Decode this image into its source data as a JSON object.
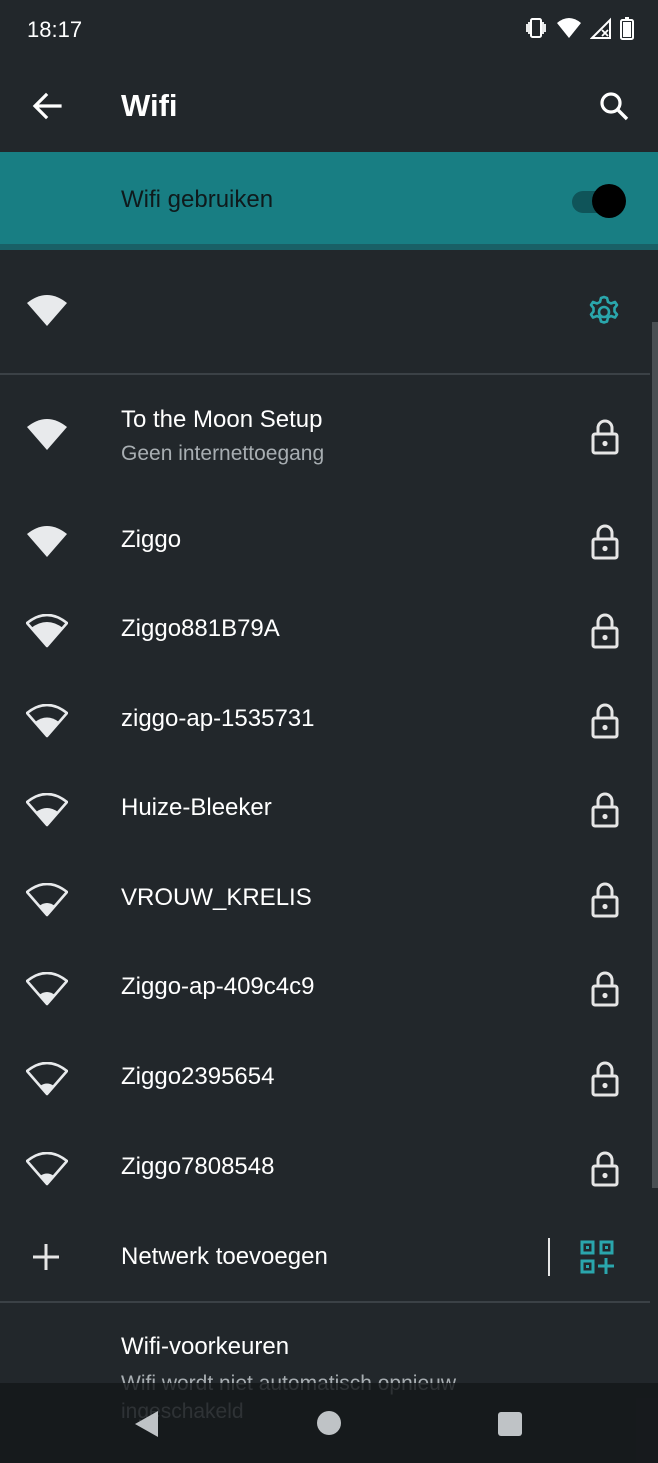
{
  "status_bar": {
    "time": "18:17"
  },
  "app_bar": {
    "title": "Wifi"
  },
  "toggle": {
    "label": "Wifi gebruiken",
    "on": true
  },
  "networks": [
    {
      "name": "To the Moon Setup",
      "subtitle": "Geen internettoegang"
    },
    {
      "name": "Ziggo"
    },
    {
      "name": "Ziggo881B79A"
    },
    {
      "name": "ziggo-ap-1535731"
    },
    {
      "name": "Huize-Bleeker"
    },
    {
      "name": "VROUW_KRELIS"
    },
    {
      "name": "Ziggo-ap-409c4c9"
    },
    {
      "name": "Ziggo2395654"
    },
    {
      "name": "Ziggo7808548"
    }
  ],
  "add_network": {
    "label": "Netwerk toevoegen"
  },
  "preferences": {
    "title": "Wifi-voorkeuren",
    "subtitle": "Wifi wordt niet automatisch opnieuw ingeschakeld"
  },
  "colors": {
    "accent": "#187e83",
    "background": "#22272b",
    "icon_teal": "#2aa6ac"
  }
}
